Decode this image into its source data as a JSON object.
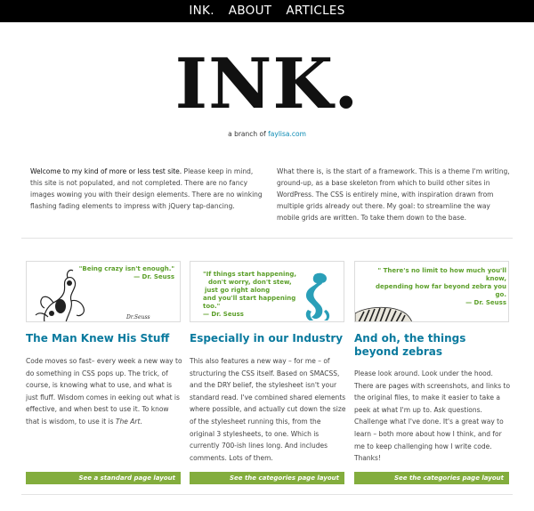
{
  "nav": {
    "items": [
      {
        "label": "INK."
      },
      {
        "label": "ABOUT"
      },
      {
        "label": "ARTICLES"
      }
    ]
  },
  "header": {
    "logo": "INK.",
    "branch_prefix": "a branch of",
    "branch_link": "faylisa.com"
  },
  "intro": {
    "left_strong": "Welcome to my kind of more or less test site.",
    "left_rest": " Please keep in mind, this site is not populated, and not completed. There are no fancy images wowing you with their design elements. There are no winking flashing fading elements to impress with jQuery tap-dancing.",
    "right": "What there is, is the start of a framework. This is a theme I'm writing, ground-up, as a base skeleton from which to build other sites in WordPress. The CSS is entirely mine, with inspiration drawn from multiple grids already out there. My goal: to streamline the way mobile grids are written. To take them down to the base."
  },
  "cards": [
    {
      "quote_lines": [
        "\"Being crazy isn't enough.\"",
        "— Dr. Seuss"
      ],
      "title": "The Man Knew His Stuff",
      "body_pre": "Code moves so fast– every week a new way to do something in CSS pops up. The trick, of course, is knowing what to use, and what is just fluff. Wisdom comes in eeking out what is effective, and when best to use it. To know that is wisdom, to use it is ",
      "body_em": "The Art",
      "body_post": ".",
      "button": "See a standard page layout"
    },
    {
      "quote_lines": [
        "\"If things start happening,",
        "don't worry, don't stew,",
        "just go right along",
        "and you'll start happening too.\"",
        "— Dr. Seuss"
      ],
      "title": "Especially in our Industry",
      "body_pre": "This also features a new way – for me – of structuring the CSS itself. Based on SMACSS, and the DRY belief, the stylesheet isn't your standard read. I've combined shared elements where possible, and actually cut down the size of the stylesheet running this, from the original 3 stylesheets, to one. Which is currently 700-ish lines long. And includes comments. Lots of them.",
      "body_em": "",
      "body_post": "",
      "button": "See the categories page layout"
    },
    {
      "quote_lines": [
        "\" There's no limit to how much you'll know,",
        "depending how far beyond zebra you go.",
        "— Dr. Seuss"
      ],
      "title": "And oh, the things beyond zebras",
      "body_pre": "Please look around. Look under the hood. There are pages with screenshots, and links to the original files, to make it easier to take a peek at what I'm up to. Ask questions. Challenge what I've done. It's a great way to learn – both more about how I think, and for me to keep challenging how I write code. Thanks!",
      "body_em": "",
      "body_post": "",
      "button": "See the categories page layout"
    }
  ],
  "colors": {
    "nav_bg": "#000000",
    "link": "#0a8ab3",
    "title": "#0a7a9e",
    "quote_green": "#5c9f2a",
    "button_green": "#83ad3d"
  }
}
